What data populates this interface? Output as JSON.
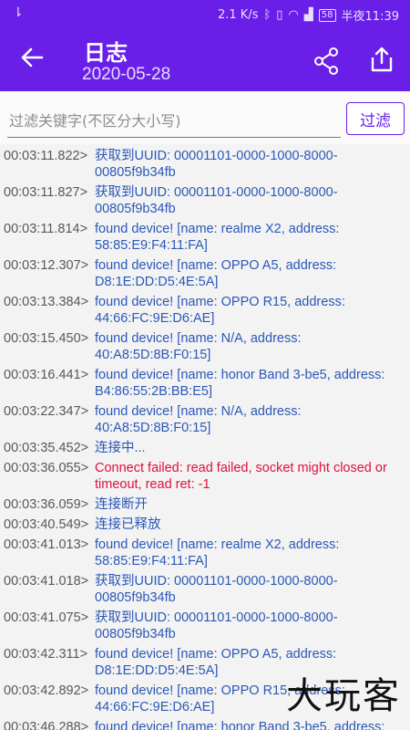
{
  "status_bar": {
    "usb_icon": "usb-icon",
    "network_speed": "2.1 K/s",
    "battery": "58",
    "time": "半夜11:39"
  },
  "toolbar": {
    "title": "日志",
    "date": "2020-05-28",
    "back_icon": "arrow-left-icon",
    "share_icon": "share-icon",
    "upload_icon": "upload-icon"
  },
  "filter": {
    "placeholder": "过滤关键字(不区分大小写)",
    "value": "",
    "button_label": "过滤"
  },
  "colors": {
    "primary": "#6a1fe9",
    "info_text": "#2a58b8",
    "error_text": "#e0113a"
  },
  "log": [
    {
      "time": "00:03:11.822>",
      "message": "获取到UUID: 00001101-0000-1000-8000-00805f9b34fb",
      "error": false
    },
    {
      "time": "00:03:11.827>",
      "message": "获取到UUID: 00001101-0000-1000-8000-00805f9b34fb",
      "error": false
    },
    {
      "time": "00:03:11.814>",
      "message": "found device! [name: realme X2, address: 58:85:E9:F4:11:FA]",
      "error": false
    },
    {
      "time": "00:03:12.307>",
      "message": "found device! [name: OPPO A5, address: D8:1E:DD:D5:4E:5A]",
      "error": false
    },
    {
      "time": "00:03:13.384>",
      "message": "found device! [name: OPPO R15, address: 44:66:FC:9E:D6:AE]",
      "error": false
    },
    {
      "time": "00:03:15.450>",
      "message": "found device! [name: N/A, address: 40:A8:5D:8B:F0:15]",
      "error": false
    },
    {
      "time": "00:03:16.441>",
      "message": "found device! [name: honor Band 3-be5, address: B4:86:55:2B:BB:E5]",
      "error": false
    },
    {
      "time": "00:03:22.347>",
      "message": "found device! [name: N/A, address: 40:A8:5D:8B:F0:15]",
      "error": false
    },
    {
      "time": "00:03:35.452>",
      "message": "连接中...",
      "error": false
    },
    {
      "time": "00:03:36.055>",
      "message": "Connect failed: read failed, socket might closed or timeout, read ret: -1",
      "error": true
    },
    {
      "time": "00:03:36.059>",
      "message": "连接断开",
      "error": false
    },
    {
      "time": "00:03:40.549>",
      "message": "连接已释放",
      "error": false
    },
    {
      "time": "00:03:41.013>",
      "message": "found device! [name: realme X2, address: 58:85:E9:F4:11:FA]",
      "error": false
    },
    {
      "time": "00:03:41.018>",
      "message": "获取到UUID: 00001101-0000-1000-8000-00805f9b34fb",
      "error": false
    },
    {
      "time": "00:03:41.075>",
      "message": "获取到UUID: 00001101-0000-1000-8000-00805f9b34fb",
      "error": false
    },
    {
      "time": "00:03:42.311>",
      "message": "found device! [name: OPPO A5, address: D8:1E:DD:D5:4E:5A]",
      "error": false
    },
    {
      "time": "00:03:42.892>",
      "message": "found device! [name: OPPO R15, address: 44:66:FC:9E:D6:AE]",
      "error": false
    },
    {
      "time": "00:03:46.288>",
      "message": "found device! [name: honor Band 3-be5, address:",
      "error": false
    }
  ],
  "watermark": "大玩客"
}
